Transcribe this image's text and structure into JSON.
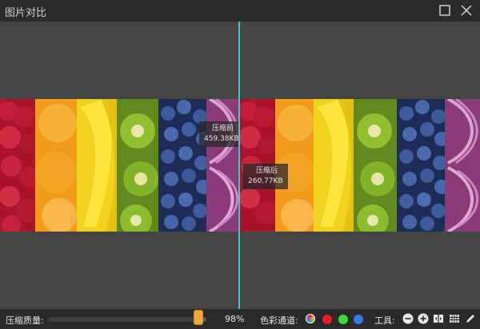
{
  "window": {
    "title": "图片对比"
  },
  "compare": {
    "before_label": "压缩前",
    "before_size": "459.38KB",
    "after_label": "压缩后",
    "after_size": "260.77KB"
  },
  "bottom": {
    "quality_label": "压缩质量:",
    "quality_value": "98%",
    "quality_fraction": 0.98,
    "channel_label": "色彩通道:",
    "channels": [
      {
        "name": "all",
        "color": "#ffffff"
      },
      {
        "name": "red",
        "color": "#e8222c"
      },
      {
        "name": "green",
        "color": "#3ad93a"
      },
      {
        "name": "blue",
        "color": "#2f7bea"
      }
    ],
    "tools_label": "工具:",
    "tools": [
      "zoom-out-icon",
      "zoom-in-icon",
      "actual-size-icon",
      "grid-icon",
      "pen-icon"
    ]
  },
  "colors": {
    "accent": "#3fc7cf",
    "thumb": "#f2a93b"
  }
}
